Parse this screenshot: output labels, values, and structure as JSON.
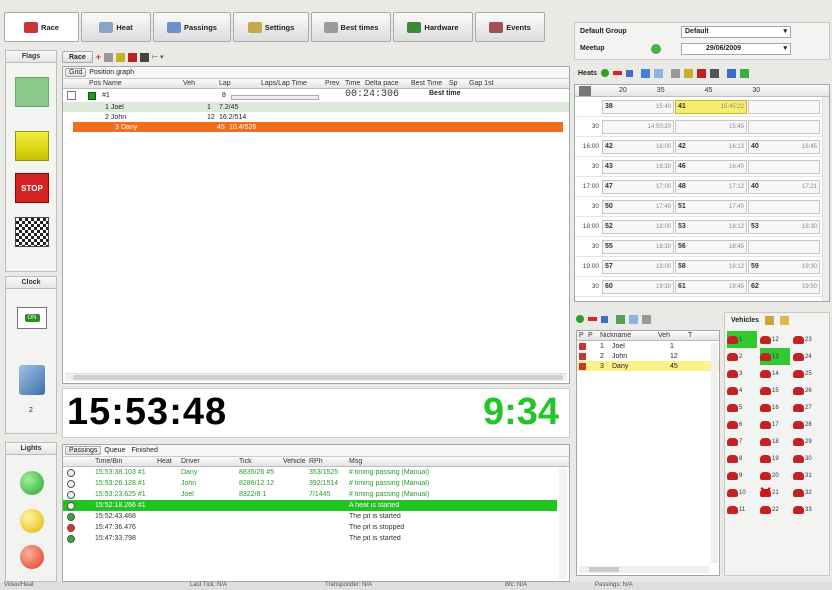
{
  "top_tabs": [
    {
      "label": "Race",
      "color": "#cc3333"
    },
    {
      "label": "Heat",
      "color": "#8aa4c8"
    },
    {
      "label": "Passings",
      "color": "#6f8fc8"
    },
    {
      "label": "Settings",
      "color": "#c8a84a"
    },
    {
      "label": "Best times",
      "color": "#9a9a9a"
    },
    {
      "label": "Hardware",
      "color": "#3a8a3a"
    },
    {
      "label": "Events",
      "color": "#a05050"
    }
  ],
  "flags": {
    "label": "Flags",
    "stop_label": "STOP"
  },
  "clock": {
    "label": "Clock",
    "badge": "ON",
    "number": "2"
  },
  "lights": {
    "label": "Lights"
  },
  "race": {
    "label": "Race",
    "sub_tabs": [
      "Grid",
      "Position graph"
    ]
  },
  "standings": {
    "columns": [
      "Pos",
      "Name",
      "Veh",
      "Lap",
      "Laps/Lap Time",
      "Prev",
      "Time",
      "Delta pace",
      "Best Time",
      "Sp",
      "Gap 1st"
    ],
    "group_row": {
      "name": "#1",
      "lap": "8"
    },
    "timer": "00:24:306",
    "best_label": "Best time",
    "rows": [
      {
        "pos": "1",
        "name": "Joel",
        "veh": "1",
        "lap": "7.2/45"
      },
      {
        "pos": "2",
        "name": "John",
        "veh": "12",
        "lap": "16.2/514"
      },
      {
        "pos": "3",
        "name": "Dany",
        "veh": "45",
        "lap": "10.4/526"
      }
    ]
  },
  "big_clock": "15:53:48",
  "countdown": "9:34",
  "bottom_tabs": [
    "Passings",
    "Queue",
    "Finished"
  ],
  "passings": {
    "columns": [
      "Time/Bin",
      "Heat",
      "Driver",
      "Tick",
      "Vehicle",
      "RPh",
      "Msg"
    ],
    "rows": [
      {
        "time": "15:53:38.103 #1",
        "heat": "",
        "driver": "Dany",
        "tick": "8835/26 #5",
        "vehicle": "",
        "rph": "353/1525",
        "msg": "# timing passing (Manual)",
        "kind": "green"
      },
      {
        "time": "15:53:26.128 #1",
        "heat": "",
        "driver": "John",
        "tick": "8286/12 12",
        "vehicle": "",
        "rph": "392/1514",
        "msg": "# timing passing (Manual)",
        "kind": "green"
      },
      {
        "time": "15:53:23.625 #1",
        "heat": "",
        "driver": "Joel",
        "tick": "8322/8 1",
        "vehicle": "",
        "rph": "7/1445",
        "msg": "# timing passing (Manual)",
        "kind": "green"
      },
      {
        "time": "15:52:18.266 #1",
        "heat": "",
        "driver": "",
        "tick": "",
        "vehicle": "",
        "rph": "",
        "msg": "A heat is started",
        "kind": "highlight"
      },
      {
        "time": "15:52:43.468",
        "heat": "",
        "driver": "",
        "tick": "",
        "vehicle": "",
        "rph": "",
        "msg": "The pit is started",
        "kind": "plain"
      },
      {
        "time": "15:47:36.476",
        "heat": "",
        "driver": "",
        "tick": "",
        "vehicle": "",
        "rph": "",
        "msg": "The pit is stopped",
        "kind": "plain"
      },
      {
        "time": "15:47:33.798",
        "heat": "",
        "driver": "",
        "tick": "",
        "vehicle": "",
        "rph": "",
        "msg": "The pit is started",
        "kind": "plain"
      }
    ]
  },
  "right_panel": {
    "group_label": "Default Group",
    "group_value": "Default",
    "meetup_label": "Meetup",
    "date_value": "29/06/2009"
  },
  "heats": {
    "label": "Heats",
    "header": [
      "20",
      "35",
      "45",
      "30"
    ],
    "rows": [
      {
        "time": "",
        "cells": [
          {
            "n": "38",
            "t": "15:40"
          },
          {
            "n": "41",
            "t": "15:45:22"
          },
          {
            "n": "",
            "t": ""
          }
        ]
      },
      {
        "time": "30",
        "cells": [
          {
            "n": "",
            "t": "14:50:20"
          },
          {
            "n": "",
            "t": "15:45"
          },
          {
            "n": "",
            "t": ""
          }
        ]
      },
      {
        "time": "16:00",
        "cells": [
          {
            "n": "42",
            "t": "16:00"
          },
          {
            "n": "42",
            "t": "16:13"
          },
          {
            "n": "40",
            "t": "16:45"
          }
        ]
      },
      {
        "time": "30",
        "cells": [
          {
            "n": "43",
            "t": "16:30"
          },
          {
            "n": "46",
            "t": "16:40"
          },
          {
            "n": "",
            "t": ""
          }
        ]
      },
      {
        "time": "17:00",
        "cells": [
          {
            "n": "47",
            "t": "17:00"
          },
          {
            "n": "48",
            "t": "17:12"
          },
          {
            "n": "40",
            "t": "17:21"
          }
        ]
      },
      {
        "time": "30",
        "cells": [
          {
            "n": "50",
            "t": "17:40"
          },
          {
            "n": "51",
            "t": "17:40"
          },
          {
            "n": "",
            "t": ""
          }
        ]
      },
      {
        "time": "18:00",
        "cells": [
          {
            "n": "52",
            "t": "18:00"
          },
          {
            "n": "53",
            "t": "18:12"
          },
          {
            "n": "53",
            "t": "18:30"
          }
        ]
      },
      {
        "time": "30",
        "cells": [
          {
            "n": "55",
            "t": "18:30"
          },
          {
            "n": "56",
            "t": "18:45"
          },
          {
            "n": "",
            "t": ""
          }
        ]
      },
      {
        "time": "19:00",
        "cells": [
          {
            "n": "57",
            "t": "19:00"
          },
          {
            "n": "58",
            "t": "19:12"
          },
          {
            "n": "59",
            "t": "19:30"
          }
        ]
      },
      {
        "time": "30",
        "cells": [
          {
            "n": "60",
            "t": "19:30"
          },
          {
            "n": "61",
            "t": "19:45"
          },
          {
            "n": "62",
            "t": "19:50"
          }
        ]
      }
    ]
  },
  "drivers": {
    "columns": [
      "P",
      "P",
      "Nickname",
      "Veh",
      "T"
    ],
    "rows": [
      {
        "p": "1",
        "name": "Joel",
        "veh": "1"
      },
      {
        "p": "2",
        "name": "John",
        "veh": "12"
      },
      {
        "p": "3",
        "name": "Dany",
        "veh": "45"
      }
    ]
  },
  "vehicles": {
    "label": "Vehicles",
    "cols": [
      [
        "1",
        "2",
        "3",
        "4",
        "5",
        "6",
        "7",
        "8",
        "9",
        "10",
        "11"
      ],
      [
        "12",
        "13",
        "14",
        "15",
        "16",
        "17",
        "18",
        "19",
        "20",
        "21",
        "22"
      ],
      [
        "23",
        "24",
        "25",
        "26",
        "27",
        "28",
        "29",
        "30",
        "31",
        "32",
        "33"
      ]
    ]
  },
  "status_bar": [
    "Video/Heat",
    "Last Tick: N/A",
    "Transponder: N/A",
    "Bfc: N/A",
    "Passings: N/A"
  ]
}
